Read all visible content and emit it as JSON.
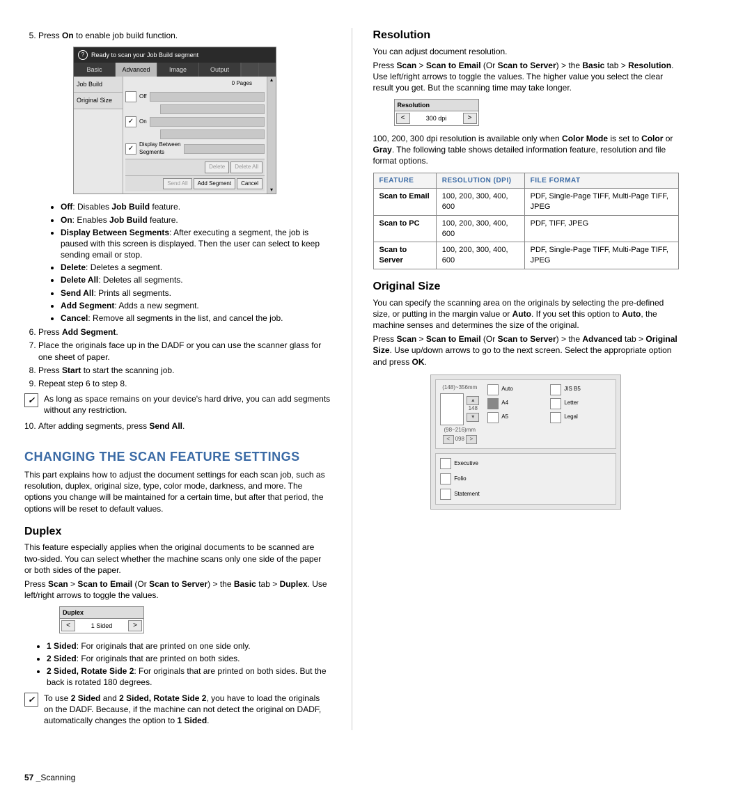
{
  "left": {
    "step5": "Press ",
    "step5_b": "On",
    "step5_after": " to enable job build function.",
    "jb": {
      "ready": "Ready to scan your Job Build segment",
      "tabs": [
        "Basic",
        "Advanced",
        "Image",
        "Output"
      ],
      "side": [
        "Job Build",
        "Original Size"
      ],
      "pages": "0 Pages",
      "opts": [
        "Off",
        "On",
        "Display Between Segments"
      ],
      "footer_r1": [
        "Delete",
        "Delete All"
      ],
      "footer_r2": [
        "Send All",
        "Add Segment",
        "Cancel"
      ]
    },
    "jb_desc": [
      [
        "Off",
        ": Disables ",
        "Job Build",
        " feature."
      ],
      [
        "On",
        ": Enables ",
        "Job Build",
        " feature."
      ],
      [
        "Display Between Segments",
        ": After executing a segment, the job is paused with this screen is displayed. Then the user can select to keep sending email or stop."
      ],
      [
        "Delete",
        ": Deletes a segment."
      ],
      [
        "Delete All",
        ": Deletes all segments."
      ],
      [
        "Send All",
        ": Prints all segments."
      ],
      [
        "Add Segment",
        ": Adds a new segment."
      ],
      [
        "Cancel",
        ": Remove all segments in the list, and cancel the job."
      ]
    ],
    "step6_pre": "Press ",
    "step6_b": "Add Segment",
    "step6_post": ".",
    "step7": "Place the originals face up in the DADF or you can use the scanner glass for one sheet of paper.",
    "step8_pre": "Press ",
    "step8_b": "Start",
    "step8_post": " to start the scanning job.",
    "step9": "Repeat step 6 to step 8.",
    "note1": "As long as space remains on your device's hard drive, you can add segments without any restriction.",
    "step10_pre": "After adding segments, press ",
    "step10_b": "Send All",
    "step10_post": ".",
    "h1": "CHANGING THE SCAN FEATURE SETTINGS",
    "h1_desc": "This part explains how to adjust the document settings for each scan job, such as resolution, duplex, original size, type, color mode, darkness, and more. The options you change will be maintained for a certain time, but after that period, the options will be reset to default values.",
    "duplex_h": "Duplex",
    "duplex_p": "This feature especially applies when the original documents to be scanned are two-sided. You can select whether the machine scans only one side of the paper or both sides of the paper.",
    "duplex_path_a": "Press ",
    "duplex_path_b": "Scan",
    "duplex_path_c": " > ",
    "duplex_path_d": "Scan to Email",
    "duplex_path_e": " (Or ",
    "duplex_path_f": "Scan to Server",
    "duplex_path_g": ") > the ",
    "duplex_path_h": "Basic",
    "duplex_path_i": " tab > ",
    "duplex_path_j": "Duplex",
    "duplex_path_k": ". Use left/right arrows to toggle the values.",
    "duplex_spin_title": "Duplex",
    "duplex_spin_val": "1 Sided",
    "duplex_opts": [
      [
        "1 Sided",
        ": For originals that are printed on one side only."
      ],
      [
        "2 Sided",
        ": For originals that are printed on both sides."
      ],
      [
        "2 Sided, Rotate Side 2",
        ": For originals that are printed on both sides. But the back is rotated 180 degrees."
      ]
    ],
    "note2_a": "To use ",
    "note2_b": "2 Sided",
    "note2_c": " and ",
    "note2_d": "2 Sided, Rotate Side 2",
    "note2_e": ", you have to load the originals on the DADF. Because, if the machine can not detect the original on DADF, automatically changes the option to ",
    "note2_f": "1 Sided",
    "note2_g": "."
  },
  "right": {
    "res_h": "Resolution",
    "res_p1": "You can adjust document resolution.",
    "res_path_a": "Press ",
    "res_path_b": "Scan",
    "res_path_c": " > ",
    "res_path_d": "Scan to Email",
    "res_path_e": " (Or ",
    "res_path_f": "Scan to Server",
    "res_path_g": ") > the ",
    "res_path_h": "Basic",
    "res_path_i": " tab > ",
    "res_path_j": "Resolution",
    "res_path_k": ". Use left/right arrows to toggle the values. The higher value you select the clear result you get. But the scanning time may take longer.",
    "res_spin_title": "Resolution",
    "res_spin_val": "300 dpi",
    "res_note_a": "100, 200, 300 dpi resolution is available only when ",
    "res_note_b": "Color Mode",
    "res_note_c": " is set to ",
    "res_note_d": "Color",
    "res_note_e": " or ",
    "res_note_f": "Gray",
    "res_note_g": ". The following table shows detailed information feature, resolution and file format options.",
    "table_h": [
      "FEATURE",
      "RESOLUTION (DPI)",
      "FILE FORMAT"
    ],
    "table_rows": [
      [
        "Scan to Email",
        "100, 200, 300, 400, 600",
        "PDF, Single-Page TIFF, Multi-Page TIFF, JPEG"
      ],
      [
        "Scan to PC",
        "100, 200, 300, 400, 600",
        "PDF, TIFF, JPEG"
      ],
      [
        "Scan to Server",
        "100, 200, 300, 400, 600",
        "PDF, Single-Page TIFF, Multi-Page TIFF, JPEG"
      ]
    ],
    "os_h": "Original Size",
    "os_p_a": "You can specify the scanning area on the originals by selecting the pre-defined size, or putting in the margin value or ",
    "os_p_b": "Auto",
    "os_p_c": ". If you set this option to ",
    "os_p_d": "Auto",
    "os_p_e": ", the machine senses and determines the size of the original.",
    "os_path_a": "Press ",
    "os_path_b": "Scan",
    "os_path_c": " > ",
    "os_path_d": "Scan to Email",
    "os_path_e": " (Or ",
    "os_path_f": "Scan to Server",
    "os_path_g": ") > the ",
    "os_path_h": "Advanced",
    "os_path_i": " tab > ",
    "os_path_j": "Original Size",
    "os_path_k": ". Use up/down arrows to go to the next screen. Select the appropriate option and press ",
    "os_path_l": "OK",
    "os_path_m": ".",
    "os_vlabel": "(148)~356mm",
    "os_vval": "148",
    "os_hlabel": "(98~216)mm",
    "os_hval": "098",
    "os_top_opts": [
      [
        "Auto",
        "JIS B5"
      ],
      [
        "A4",
        "Letter"
      ],
      [
        "A5",
        "Legal"
      ]
    ],
    "os_bot_opts": [
      "Executive",
      "Folio",
      "Statement"
    ]
  },
  "footer_num": "57 _",
  "footer_txt": "Scanning"
}
